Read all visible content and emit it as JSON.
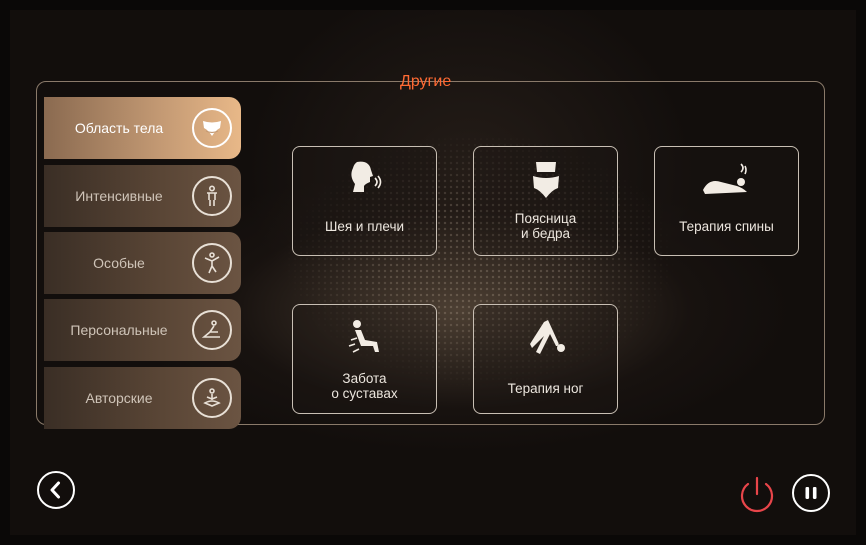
{
  "header": {
    "title": "Другие"
  },
  "sidebar": {
    "items": [
      {
        "label": "Область тела",
        "icon": "body-area-icon",
        "active": true
      },
      {
        "label": "Интенсивные",
        "icon": "intensive-figure-icon",
        "active": false
      },
      {
        "label": "Особые",
        "icon": "special-figure-icon",
        "active": false
      },
      {
        "label": "Персональные",
        "icon": "personal-yoga-icon",
        "active": false
      },
      {
        "label": "Авторские",
        "icon": "author-meditation-icon",
        "active": false
      }
    ]
  },
  "programs": [
    {
      "label": "Шея и плечи",
      "icon": "neck-shoulders-icon"
    },
    {
      "label": "Поясница\nи бедра",
      "icon": "lower-back-hips-icon"
    },
    {
      "label": "Терапия спины",
      "icon": "back-therapy-icon"
    },
    {
      "label": "Забота\nо суставах",
      "icon": "joint-care-icon"
    },
    {
      "label": "Терапия ног",
      "icon": "leg-therapy-icon"
    }
  ],
  "controls": {
    "back_icon": "chevron-left-icon",
    "power_icon": "power-icon",
    "pause_icon": "pause-icon",
    "power_color": "#e8454a",
    "accent": "#ff6a33"
  }
}
